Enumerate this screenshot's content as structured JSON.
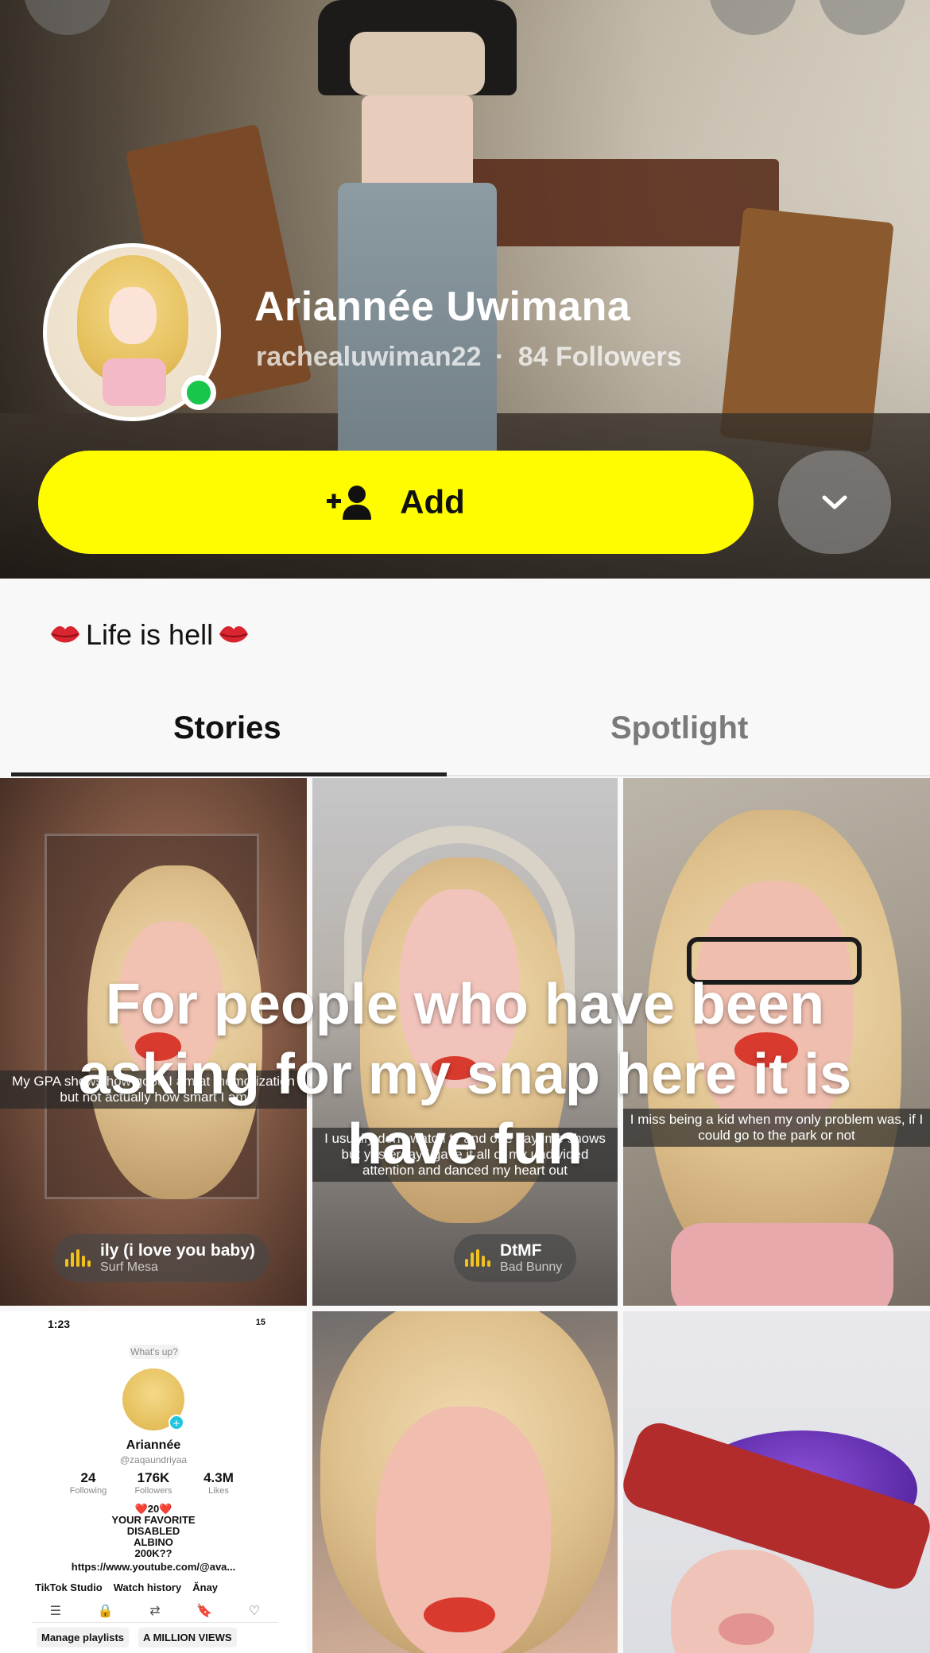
{
  "profile": {
    "display_name": "Ariannée Uwimana",
    "username": "rachealuwiman22",
    "separator": "·",
    "followers": "84 Followers",
    "online_color": "#17c64a"
  },
  "actions": {
    "add_label": "Add",
    "add_button_color": "#fffc00"
  },
  "bio": {
    "text": "Life is hell",
    "emoji": "kiss-mark-icon"
  },
  "tabs": [
    {
      "label": "Stories",
      "active": true
    },
    {
      "label": "Spotlight",
      "active": false
    }
  ],
  "grid": {
    "overlay_text": "For people who have been asking for my snap here it is have fun",
    "tiles": [
      {
        "caption": "My GPA shows how good I am at memorization but not actually how smart I am",
        "song": "ily (i love you baby)",
        "artist": "Surf Mesa"
      },
      {
        "caption": "I usually don't watch tv and one daytime shows but yesterday i gave it all of my undivided attention and danced my heart out",
        "song": "DtMF",
        "artist": "Bad Bunny"
      },
      {
        "caption": "I miss being a kid when my only problem was, if I could go to the park or not"
      }
    ],
    "tiktok_screenshot": {
      "time": "1:23",
      "battery": "15",
      "bubble": "What's up?",
      "name": "Ariannée",
      "handle": "@zaqaundriyaa",
      "stats": [
        {
          "value": "24",
          "label": "Following"
        },
        {
          "value": "176K",
          "label": "Followers"
        },
        {
          "value": "4.3M",
          "label": "Likes"
        }
      ],
      "bio_lines": [
        "❤️20❤️",
        "YOUR FAVORITE",
        "DISABLED",
        "ALBINO",
        "200K??"
      ],
      "link": "https://www.youtube.com/@ava...",
      "row_items": [
        "TikTok Studio",
        "Watch history",
        "Ănay"
      ],
      "buttons": [
        "Manage playlists",
        "A MILLION VIEWS"
      ]
    }
  }
}
